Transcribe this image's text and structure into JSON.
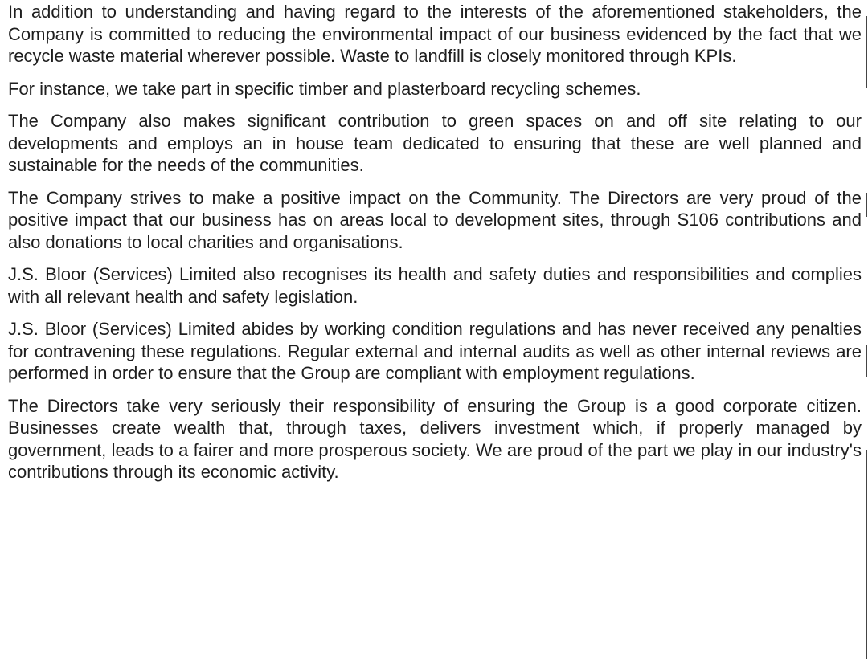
{
  "document": {
    "paragraphs": [
      "In addition to understanding and having regard to the interests of the aforementioned stakeholders, the Company is committed to reducing the environmental impact of our business evidenced by the fact that we recycle waste material wherever possible. Waste to landfill is closely monitored through KPIs.",
      "For instance, we take part in specific timber and plasterboard recycling schemes.",
      "The Company also makes significant contribution to green spaces on and off site relating to our developments and employs an in house team dedicated to ensuring that these are well planned and sustainable for the needs of the communities.",
      "The Company strives to make a positive impact on the Community. The Directors are very proud of the positive impact that our business has on areas local to development sites, through S106 contributions and also donations to local charities and organisations.",
      "J.S. Bloor (Services) Limited also recognises its health and safety duties and responsibilities and complies with all relevant health and safety legislation.",
      "J.S. Bloor (Services) Limited abides by working condition regulations and has never received any penalties for contravening these regulations. Regular external and internal audits as well as other internal reviews are performed in order to ensure that the Group are compliant with employment regulations.",
      "The Directors take very seriously their responsibility of ensuring the Group is a good corporate citizen. Businesses create wealth that, through taxes, delivers investment which, if properly managed by government, leads to a fairer and more prosperous society. We are proud of the part we play in our industry's contributions through its economic activity."
    ]
  }
}
